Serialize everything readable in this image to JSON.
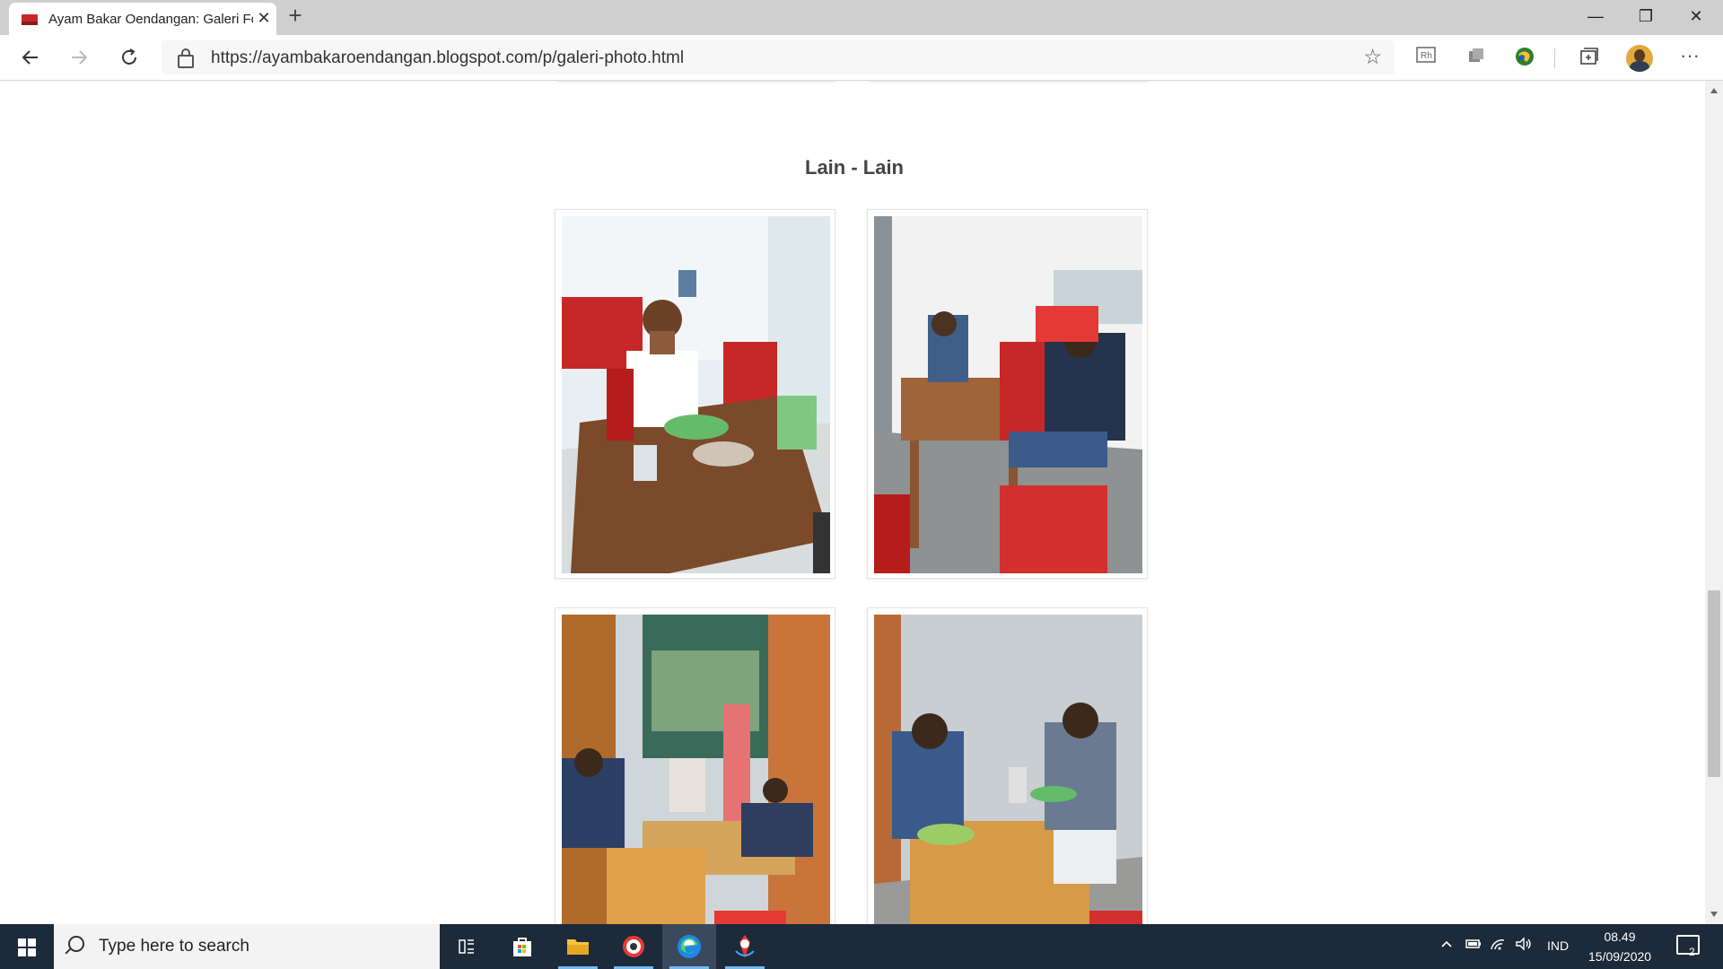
{
  "browser": {
    "tab_title": "Ayam Bakar Oendangan: Galeri Foto",
    "tab_close": "✕",
    "new_tab": "+",
    "url": "https://ayambakaroendangan.blogspot.com/p/galeri-photo.html",
    "window_buttons": [
      "—",
      "❐",
      "✕"
    ],
    "toolbar_icons": [
      "read-aloud",
      "extensions",
      "globe",
      "collections",
      "profile",
      "more"
    ],
    "more_label": "···"
  },
  "page": {
    "section_heading": "Lain - Lain",
    "photos": [
      {
        "alt": "Man seated at a restaurant table with grilled chicken"
      },
      {
        "alt": "Two men seated at tables with red chairs"
      },
      {
        "alt": "Group of diners at tables inside the restaurant"
      },
      {
        "alt": "Two men seated at a table with food and drinks"
      }
    ]
  },
  "taskbar": {
    "search_placeholder": "Type here to search",
    "language": "IND",
    "time": "08.49",
    "date": "15/09/2020",
    "notification_count": "2"
  },
  "colors": {
    "taskbar_bg": "#1c2a3a",
    "tab_strip_bg": "#cfcfcf",
    "accent": "#76b9ed"
  }
}
